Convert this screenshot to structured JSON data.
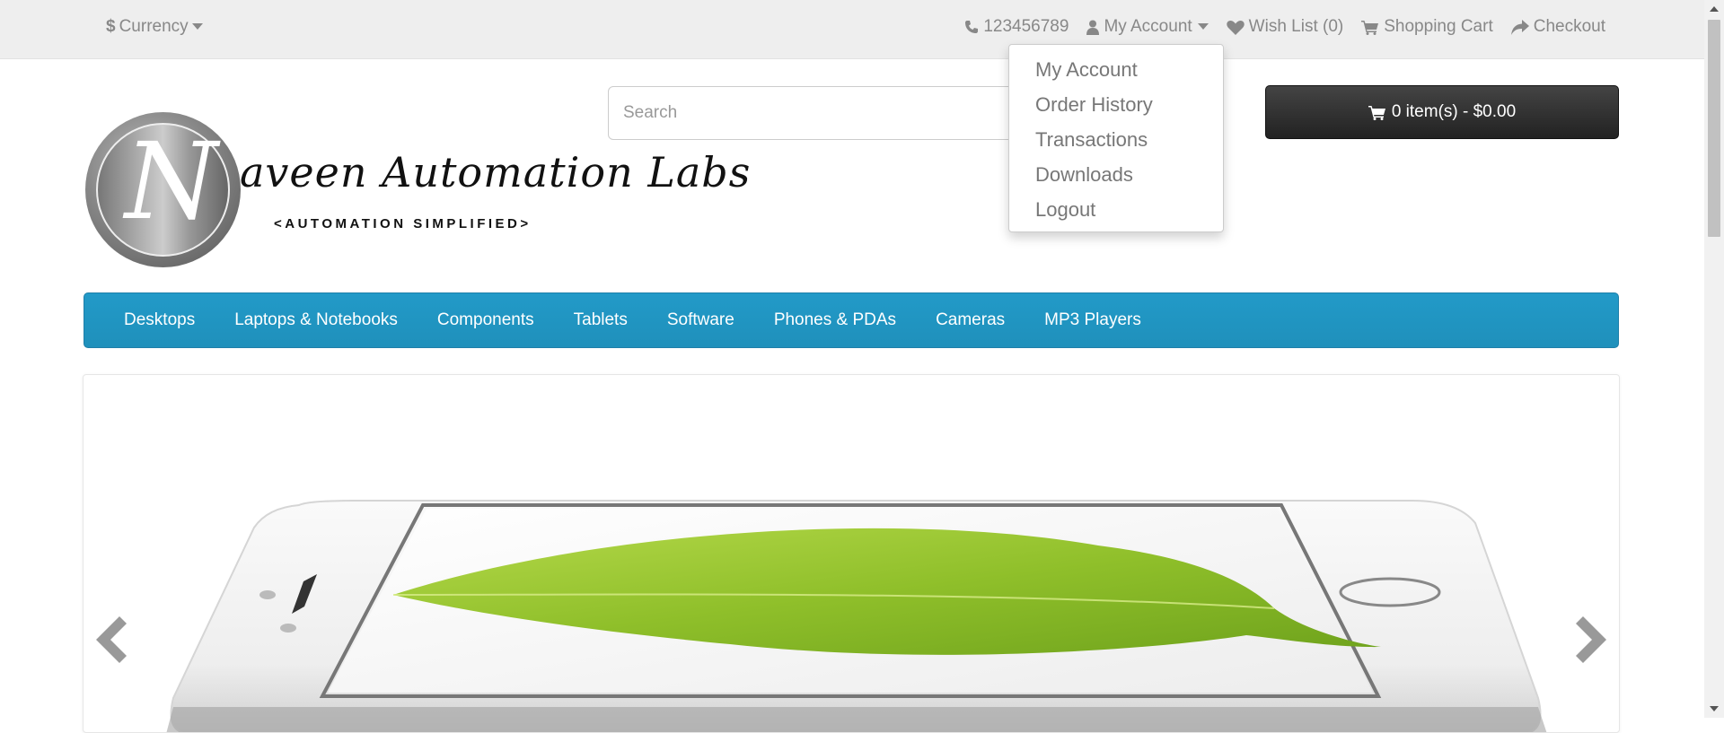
{
  "topbar": {
    "currency_label": "Currency",
    "phone": "123456789",
    "my_account": "My Account",
    "wishlist": "Wish List (0)",
    "shopping_cart": "Shopping Cart",
    "checkout": "Checkout"
  },
  "account_dropdown": {
    "items": [
      {
        "label": "My Account"
      },
      {
        "label": "Order History"
      },
      {
        "label": "Transactions"
      },
      {
        "label": "Downloads"
      },
      {
        "label": "Logout"
      }
    ]
  },
  "logo": {
    "letter": "N",
    "title": "aveen Automation Labs",
    "subtitle": "<AUTOMATION SIMPLIFIED>"
  },
  "search": {
    "placeholder": "Search",
    "value": ""
  },
  "cart": {
    "label": "0 item(s) - $0.00"
  },
  "menu": {
    "items": [
      {
        "label": "Desktops"
      },
      {
        "label": "Laptops & Notebooks"
      },
      {
        "label": "Components"
      },
      {
        "label": "Tablets"
      },
      {
        "label": "Software"
      },
      {
        "label": "Phones & PDAs"
      },
      {
        "label": "Cameras"
      },
      {
        "label": "MP3 Players"
      }
    ]
  },
  "colors": {
    "menu_blue": "#229ac8",
    "cart_dark": "#333333",
    "leaf_green": "#8bc34a"
  }
}
